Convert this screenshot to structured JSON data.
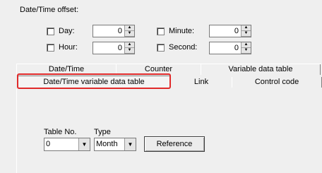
{
  "offset": {
    "title": "Date/Time offset:",
    "fields": [
      {
        "label": "Day:",
        "value": "0"
      },
      {
        "label": "Minute:",
        "value": "0"
      },
      {
        "label": "Hour:",
        "value": "0"
      },
      {
        "label": "Second:",
        "value": "0"
      }
    ]
  },
  "tabs": {
    "back_row": [
      "Date/Time",
      "Counter",
      "Variable data table"
    ],
    "front_row": [
      "Date/Time variable data table",
      "Link",
      "Control code"
    ]
  },
  "panel": {
    "table_no_label": "Table No.",
    "type_label": "Type",
    "table_no_value": "0",
    "type_value": "Month",
    "reference_label": "Reference"
  },
  "colors": {
    "highlight": "#e02a2a"
  },
  "icons": {
    "spin_up": "▲",
    "spin_down": "▼",
    "dropdown": "▼"
  }
}
